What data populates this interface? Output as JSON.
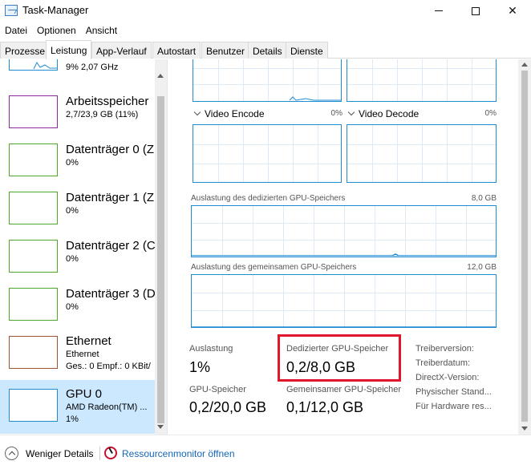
{
  "window": {
    "title": "Task-Manager",
    "minimize": "—",
    "maximize": "☐",
    "close": "✕"
  },
  "menu": [
    "Datei",
    "Optionen",
    "Ansicht"
  ],
  "tabs": [
    "Prozesse",
    "Leistung",
    "App-Verlauf",
    "Autostart",
    "Benutzer",
    "Details",
    "Dienste"
  ],
  "active_tab": "Leistung",
  "sidebar": {
    "items": [
      {
        "name": "",
        "sub": "9% 2,07 GHz",
        "color": "#1f8bd1"
      },
      {
        "name": "Arbeitsspeicher",
        "sub": "2,7/23,9 GB (11%)",
        "color": "#8b2a9c"
      },
      {
        "name": "Datenträger 0 (Z",
        "sub": "0%",
        "color": "#4ea72c"
      },
      {
        "name": "Datenträger 1 (Z",
        "sub": "0%",
        "color": "#4ea72c"
      },
      {
        "name": "Datenträger 2 (C",
        "sub": "0%",
        "color": "#4ea72c"
      },
      {
        "name": "Datenträger 3 (D",
        "sub": "0%",
        "color": "#4ea72c"
      },
      {
        "name": "Ethernet",
        "sub": "Ethernet",
        "sub2": "Ges.: 0 Empf.: 0 KBit/",
        "color": "#a0522d"
      },
      {
        "name": "GPU 0",
        "sub": "AMD Radeon(TM) ...",
        "sub2": "1%",
        "color": "#1f8bd1"
      }
    ]
  },
  "gpu": {
    "engines": [
      {
        "label": "Video Encode",
        "pct": "0%"
      },
      {
        "label": "Video Decode",
        "pct": "0%"
      }
    ],
    "dedicated_mem_label": "Auslastung des dedizierten GPU-Speichers",
    "dedicated_mem_max": "8,0 GB",
    "shared_mem_label": "Auslastung des gemeinsamen GPU-Speichers",
    "shared_mem_max": "12,0 GB",
    "stats": {
      "utilization_label": "Auslastung",
      "utilization_value": "1%",
      "dedicated_label": "Dedizierter GPU-Speicher",
      "dedicated_value": "0,2/8,0 GB",
      "gpu_mem_label": "GPU-Speicher",
      "gpu_mem_value": "0,2/20,0 GB",
      "shared_label": "Gemeinsamer GPU-Speicher",
      "shared_value": "0,1/12,0 GB"
    },
    "driver": {
      "version": "Treiberversion:",
      "date": "Treiberdatum:",
      "directx": "DirectX-Version:",
      "location": "Physischer Stand...",
      "reserved": "Für Hardware res..."
    }
  },
  "bottom": {
    "less_details": "Weniger Details",
    "resmon": "Ressourcenmonitor öffnen"
  },
  "colors": {
    "accent": "#1f8bd1",
    "highlight": "#e0162b",
    "selected_bg": "#cce8ff"
  }
}
